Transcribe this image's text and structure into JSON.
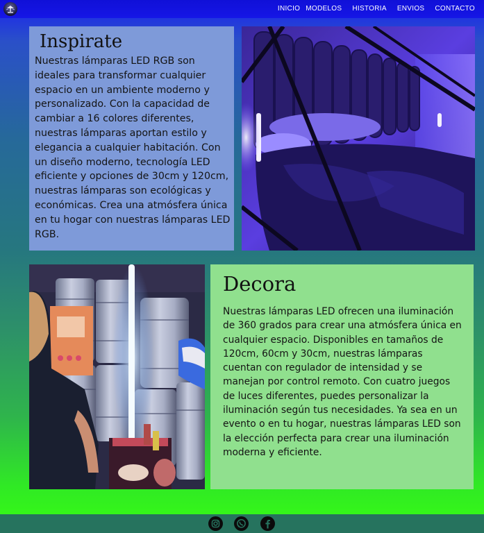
{
  "nav": {
    "items": [
      {
        "label": "INICIO"
      },
      {
        "label": "MODELOS"
      },
      {
        "label": "HISTORIA"
      },
      {
        "label": "ENVIOS"
      },
      {
        "label": "CONTACTO"
      }
    ],
    "logo_icon": "lamp-logo-icon"
  },
  "sections": {
    "inspirate": {
      "title": "Inspirate",
      "body": "Nuestras lámparas LED RGB son ideales para transformar cualquier espacio en un ambiente moderno y personalizado. Con la capacidad de cambiar a 16 colores diferentes, nuestras lámparas aportan estilo y elegancia a cualquier habitación. Con un diseño moderno, tecnología LED eficiente y opciones de 30cm y 120cm, nuestras lámparas son ecológicas y económicas. Crea una atmósfera única en tu hogar con nuestras lámparas LED RGB.",
      "card_color": "#7e9ad9"
    },
    "decora": {
      "title": "Decora",
      "body": "Nuestras lámparas LED ofrecen una iluminación de 360 grados para crear una atmósfera única en cualquier espacio. Disponibles en tamaños de 120cm, 60cm y 30cm, nuestras lámparas cuentan con regulador de intensidad y se manejan por control remoto. Con cuatro juegos de luces diferentes, puedes personalizar la iluminación según tus necesidades. Ya sea en un evento o en tu hogar, nuestras lámparas LED son la elección perfecta para crear una iluminación moderna y eficiente.",
      "card_color": "#90e08e"
    }
  },
  "footer": {
    "social": [
      "instagram-icon",
      "whatsapp-icon",
      "facebook-icon"
    ],
    "color": "#26735e"
  },
  "colors": {
    "nav": "#1616e6",
    "gradient_top": "#1a22f0",
    "gradient_bottom": "#34f51a"
  }
}
